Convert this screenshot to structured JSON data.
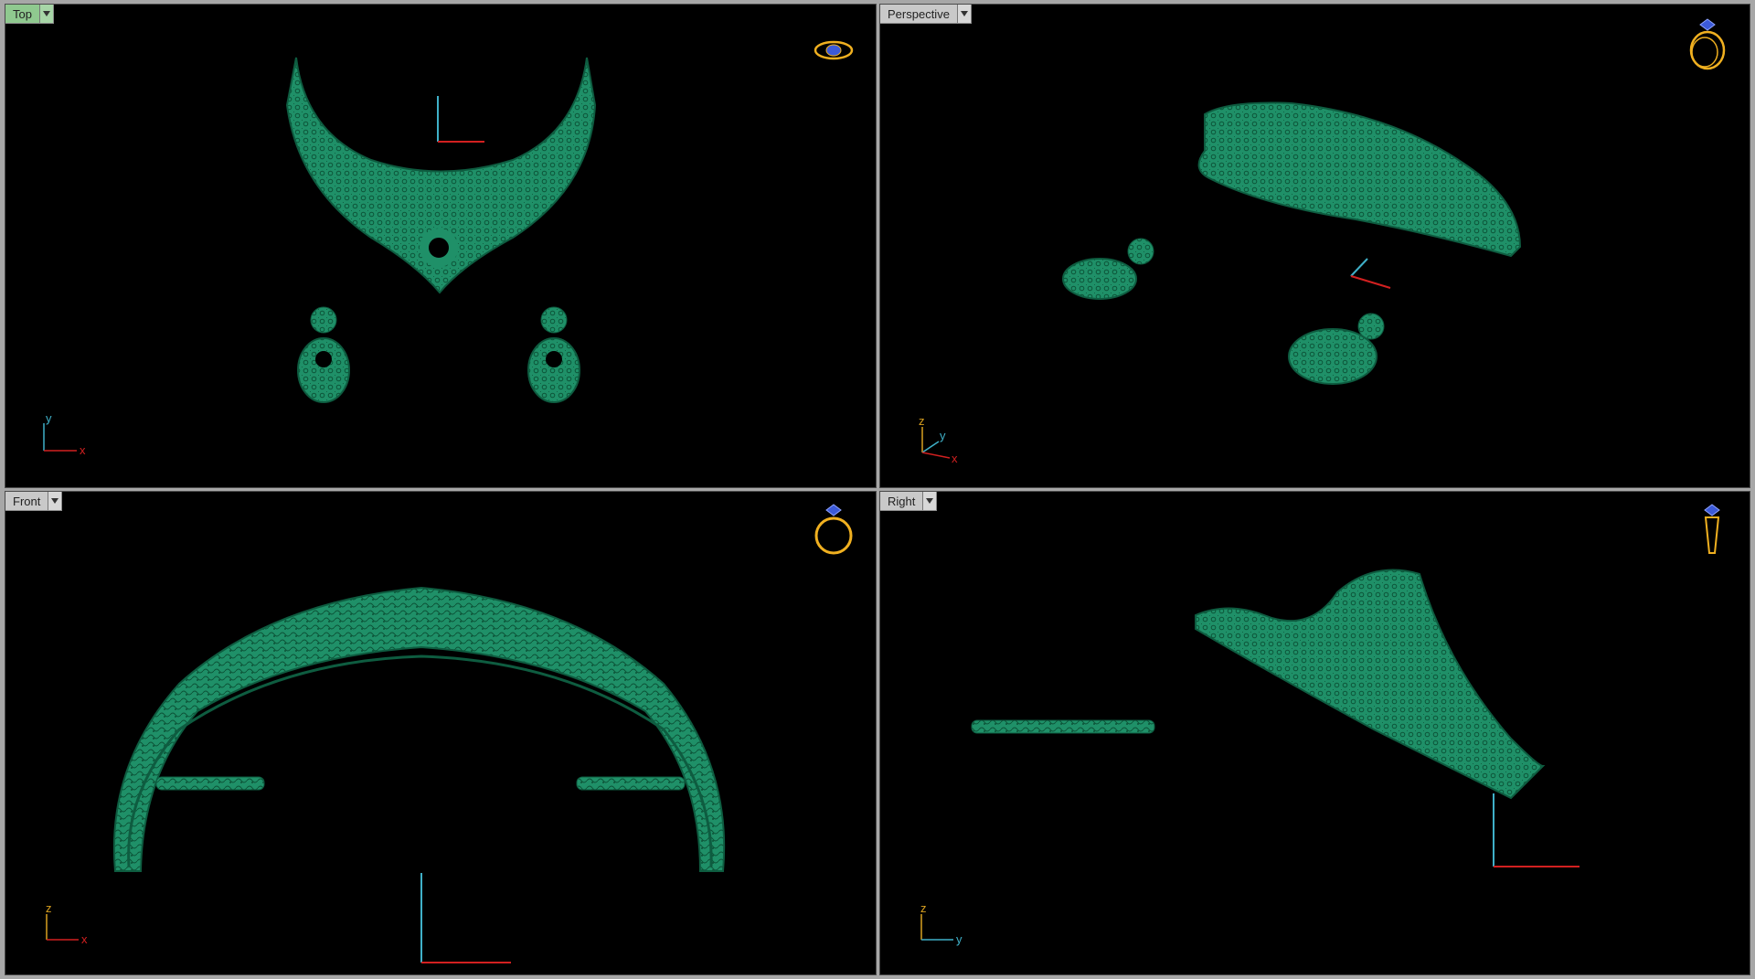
{
  "colors": {
    "background": "#000000",
    "model": "#1f9068",
    "model_edge": "#0e5c40",
    "axis_x": "#d22020",
    "axis_y": "#3fb0c8",
    "axis_z": "#d8a020",
    "tab_active": "#8fc98f",
    "tab_inactive": "#c9c9c9",
    "navcube_ring": "#f0b020",
    "navcube_gem": "#3c5ad8"
  },
  "viewports": {
    "top": {
      "title": "Top",
      "active": true,
      "axes": [
        "y",
        "x"
      ],
      "navcube_icon": "ring-top-view-icon"
    },
    "perspective": {
      "title": "Perspective",
      "active": false,
      "axes": [
        "z",
        "y",
        "x"
      ],
      "navcube_icon": "ring-perspective-icon"
    },
    "front": {
      "title": "Front",
      "active": false,
      "axes": [
        "z",
        "x"
      ],
      "navcube_icon": "ring-front-view-icon"
    },
    "right": {
      "title": "Right",
      "active": false,
      "axes": [
        "z",
        "y"
      ],
      "navcube_icon": "ring-side-view-icon"
    }
  }
}
